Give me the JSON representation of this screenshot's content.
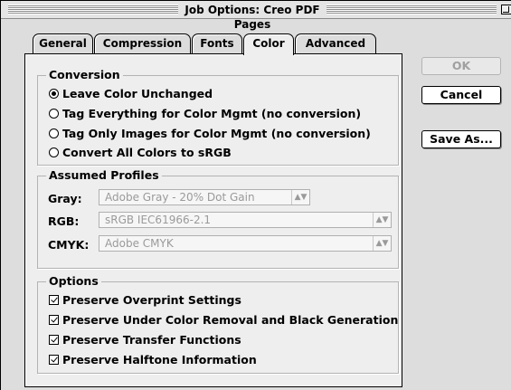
{
  "window": {
    "title": "Job Options: Creo PDF Pages"
  },
  "tabs": [
    {
      "label": "General"
    },
    {
      "label": "Compression"
    },
    {
      "label": "Fonts"
    },
    {
      "label": "Color",
      "active": true
    },
    {
      "label": "Advanced"
    }
  ],
  "conversion": {
    "title": "Conversion",
    "options": [
      {
        "label": "Leave Color Unchanged",
        "selected": true
      },
      {
        "label": "Tag Everything for Color Mgmt (no conversion)",
        "selected": false
      },
      {
        "label": "Tag Only Images for Color Mgmt (no conversion)",
        "selected": false
      },
      {
        "label": "Convert All Colors to sRGB",
        "selected": false
      }
    ]
  },
  "profiles": {
    "title": "Assumed Profiles",
    "gray": {
      "label": "Gray:",
      "value": "Adobe Gray - 20% Dot Gain"
    },
    "rgb": {
      "label": "RGB:",
      "value": "sRGB IEC61966-2.1"
    },
    "cmyk": {
      "label": "CMYK:",
      "value": "Adobe CMYK"
    }
  },
  "options": {
    "title": "Options",
    "items": [
      {
        "label": "Preserve Overprint Settings",
        "checked": true
      },
      {
        "label": "Preserve Under Color Removal and Black Generation",
        "checked": true
      },
      {
        "label": "Preserve Transfer Functions",
        "checked": true
      },
      {
        "label": "Preserve Halftone Information",
        "checked": true
      }
    ]
  },
  "buttons": {
    "ok": "OK",
    "cancel": "Cancel",
    "save_as": "Save As..."
  },
  "icons": {
    "popup_arrow": "updown-arrows-icon",
    "zoom": "zoom-box-icon"
  }
}
